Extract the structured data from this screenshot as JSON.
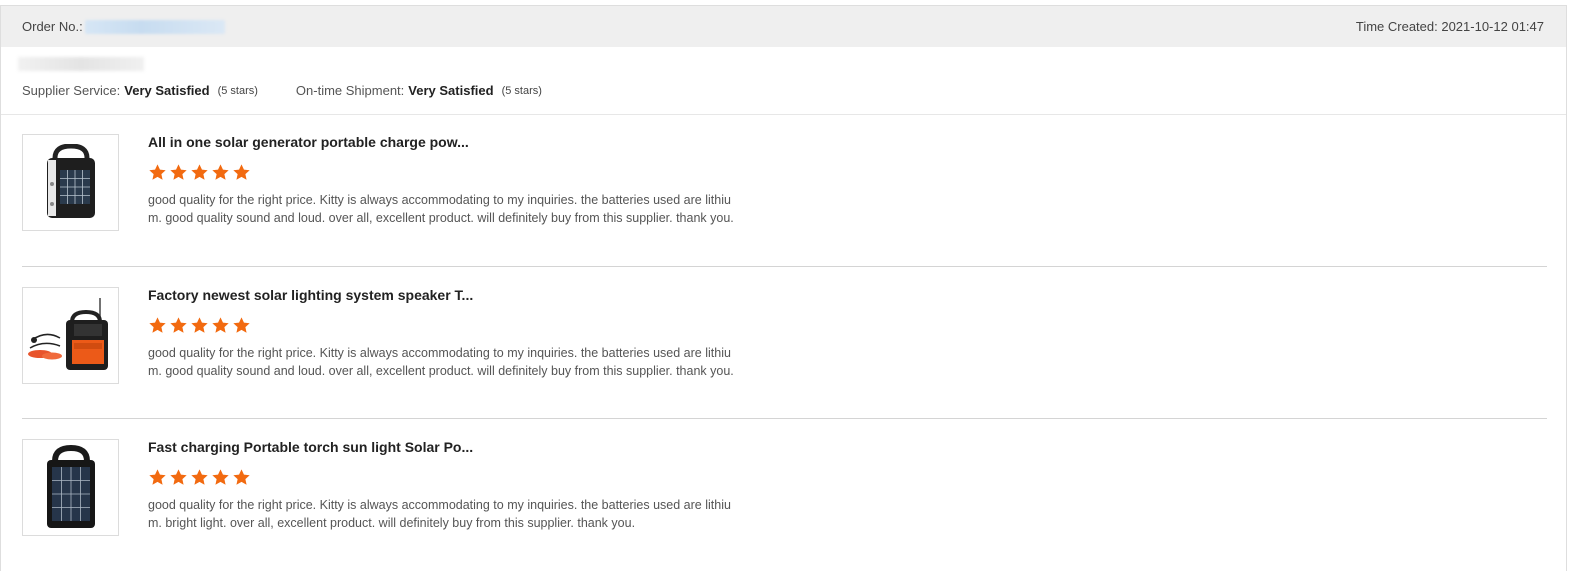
{
  "header": {
    "order_label": "Order No.:",
    "time_created": "Time Created: 2021-10-12 01:47"
  },
  "ratings": {
    "supplier_service_label": "Supplier Service:",
    "supplier_service_value": "Very Satisfied",
    "supplier_service_stars": "(5 stars)",
    "shipment_label": "On-time Shipment:",
    "shipment_value": "Very Satisfied",
    "shipment_stars": "(5 stars)"
  },
  "colors": {
    "star": "#f26a10",
    "header_bg": "#efefef"
  },
  "items": [
    {
      "title": "All in one solar generator portable charge pow...",
      "rating": 5,
      "review_line1": "good quality for the right price. Kitty is always accommodating to my inquiries. the batteries used are lithiu",
      "review_line2": "m. good quality sound and loud. over all, excellent product. will definitely buy from this supplier. thank you."
    },
    {
      "title": "Factory newest solar lighting system speaker T...",
      "rating": 5,
      "review_line1": "good quality for the right price. Kitty is always accommodating to my inquiries. the batteries used are lithiu",
      "review_line2": "m. good quality sound and loud. over all, excellent product. will definitely buy from this supplier. thank you."
    },
    {
      "title": "Fast charging Portable torch sun light Solar Po...",
      "rating": 5,
      "review_line1": "good quality for the right price. Kitty is always accommodating to my inquiries. the batteries used are lithiu",
      "review_line2": "m. bright light. over all, excellent product. will definitely buy from this supplier. thank you."
    }
  ]
}
